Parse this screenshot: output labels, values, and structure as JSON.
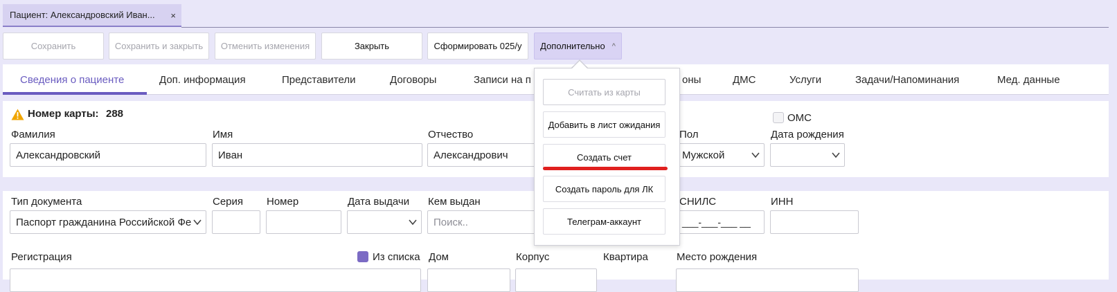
{
  "doc_tab": {
    "title": "Пациент: Александровский Иван...",
    "close": "×"
  },
  "toolbar": {
    "save": "Сохранить",
    "save_close": "Сохранить и закрыть",
    "cancel_changes": "Отменить изменения",
    "close": "Закрыть",
    "form_025": "Сформировать 025/у",
    "more": "Дополнительно",
    "more_caret": "^"
  },
  "tabs": {
    "t1": "Сведения о пациенте",
    "t2": "Доп. информация",
    "t3": "Представители",
    "t4": "Договоры",
    "t5": "Записи на п",
    "t6": "оны",
    "t7": "ДМС",
    "t8": "Услуги",
    "t9": "Задачи/Напоминания",
    "t10": "Мед. данные"
  },
  "patient": {
    "card_label": "Номер карты:",
    "card_number": "288",
    "oms_label": "ОМС",
    "surname_label": "Фамилия",
    "surname": "Александровский",
    "name_label": "Имя",
    "name": "Иван",
    "patronymic_label": "Отчество",
    "patronymic": "Александрович",
    "sex_label": "Пол",
    "sex": "Мужской",
    "birth_label": "Дата рождения",
    "birth": ""
  },
  "document": {
    "type_label": "Тип документа",
    "type": "Паспорт гражданина Российской Фе",
    "series_label": "Серия",
    "number_label": "Номер",
    "issue_date_label": "Дата выдачи",
    "issued_by_label": "Кем выдан",
    "issued_by_placeholder": "Поиск..",
    "snils_label": "СНИЛС",
    "snils_mask": "___-___-___ __",
    "inn_label": "ИНН"
  },
  "address": {
    "registration_label": "Регистрация",
    "from_list_label": "Из списка",
    "house_label": "Дом",
    "building_label": "Корпус",
    "flat_label": "Квартира",
    "birthplace_label": "Место рождения"
  },
  "dropdown": {
    "read_card": "Считать из карты",
    "add_waitlist": "Добавить в лист ожидания",
    "create_invoice": "Создать счет",
    "create_password": "Создать пароль для ЛК",
    "telegram": "Телеграм-аккаунт"
  },
  "colors": {
    "accent": "#6a5cc0",
    "highlight": "#e0201f",
    "warning": "#f0a500"
  }
}
